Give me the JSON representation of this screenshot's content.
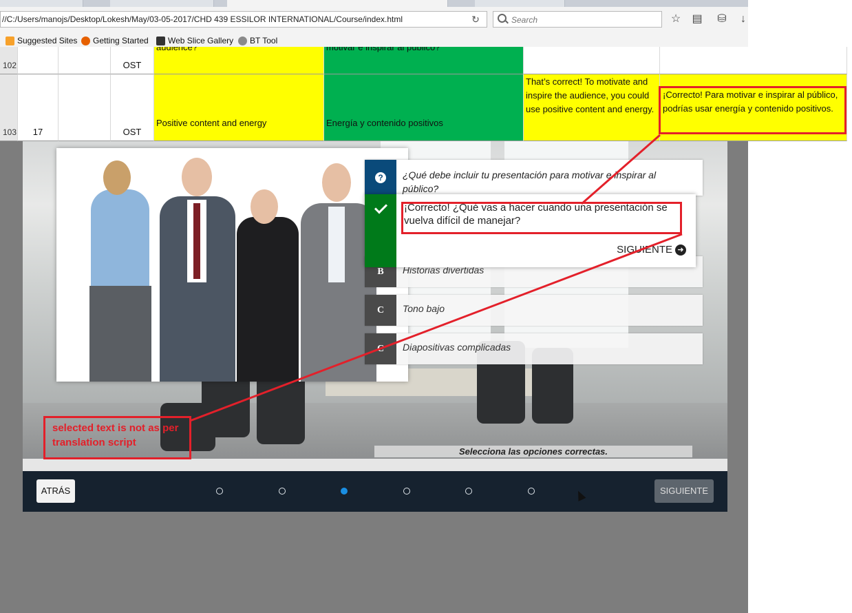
{
  "browser": {
    "url": "//C:/Users/manojs/Desktop/Lokesh/May/03-05-2017/CHD 439 ESSILOR INTERNATIONAL/Course/index.html",
    "search_placeholder": "Search",
    "bookmarks": [
      "Suggested Sites",
      "Getting Started",
      "Web Slice Gallery",
      "BT Tool"
    ]
  },
  "sheet": {
    "rows": [
      {
        "row_number": "102",
        "col_b": "",
        "col_d": "OST",
        "english": "audience?",
        "spanish": "motivar e inspirar al público?",
        "feedback_en": "",
        "feedback_es": ""
      },
      {
        "row_number": "103",
        "col_b": "17",
        "col_d": "OST",
        "english": "Positive content and energy",
        "spanish": "Energía y contenido positivos",
        "feedback_en": "That’s correct! To motivate and inspire the audience, you could use positive content and energy.",
        "feedback_es": "¡Correcto! Para motivar e inspirar al público, podrías usar energía y contenido positivos."
      }
    ]
  },
  "course": {
    "question": "¿Qué debe incluir tu presentación para motivar e inspirar al público?",
    "feedback_text": "¡Correcto! ¿Qué vas a hacer cuando una presentación se vuelva difícil de manejar?",
    "feedback_next": "SIGUIENTE",
    "options": [
      {
        "letter": "B",
        "text": "Historias divertidas"
      },
      {
        "letter": "C",
        "text": "Tono bajo"
      },
      {
        "letter": "C",
        "text": "Diapositivas complicadas"
      }
    ],
    "instruction": "Selecciona las opciones correctas.",
    "back_label": "ATRÁS",
    "next_label": "SIGUIENTE",
    "progress": {
      "total": 6,
      "current": 3
    }
  },
  "annotation": {
    "note": "selected text is not as per translation script",
    "color": "#e3202a"
  }
}
